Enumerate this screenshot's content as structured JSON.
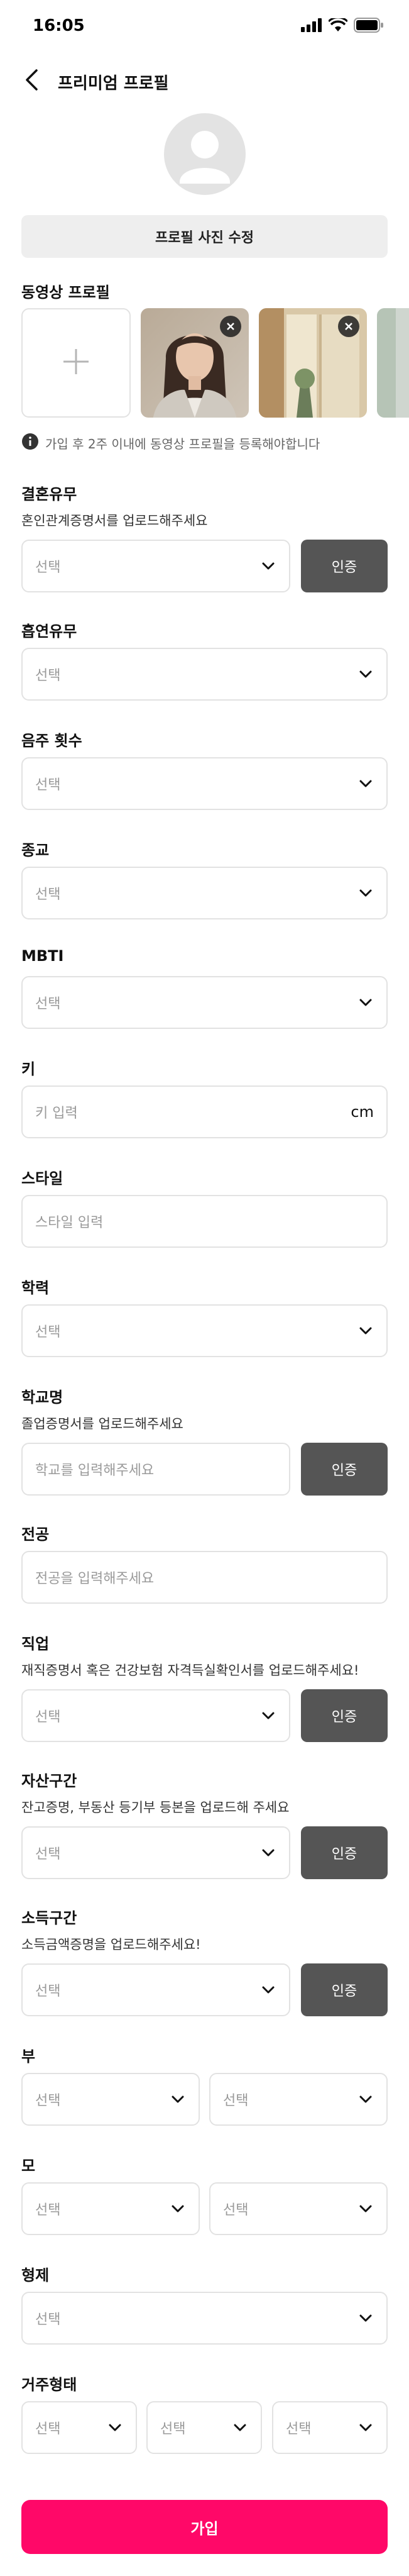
{
  "status": {
    "time": "16:05"
  },
  "nav": {
    "title": "프리미엄 프로필"
  },
  "profile": {
    "photo_edit_label": "프로필 사진 수정"
  },
  "video_profile": {
    "label": "동영상 프로필",
    "notice": "가입 후 2주 이내에 동영상 프로필을 등록해야합니다"
  },
  "common": {
    "select_placeholder": "선택",
    "cert_label": "인증"
  },
  "marriage": {
    "label": "결혼유무",
    "sub": "혼인관계증명서를 업로드해주세요"
  },
  "smoking": {
    "label": "흡연유무"
  },
  "drinking": {
    "label": "음주 횟수"
  },
  "religion": {
    "label": "종교"
  },
  "mbti": {
    "label": "MBTI"
  },
  "height": {
    "label": "키",
    "placeholder": "키 입력",
    "unit": "cm"
  },
  "style": {
    "label": "스타일",
    "placeholder": "스타일 입력"
  },
  "education": {
    "label": "학력"
  },
  "school": {
    "label": "학교명",
    "sub": "졸업증명서를 업로드해주세요",
    "placeholder": "학교를 입력해주세요"
  },
  "major": {
    "label": "전공",
    "placeholder": "전공을 입력해주세요"
  },
  "job": {
    "label": "직업",
    "sub": "재직증명서 혹은 건강보험 자격득실확인서를 업로드해주세요!"
  },
  "assets": {
    "label": "자산구간",
    "sub": "잔고증명, 부동산 등기부 등본을 업로드해 주세요"
  },
  "income": {
    "label": "소득구간",
    "sub": "소득금액증명을 업로드해주세요!"
  },
  "father": {
    "label": "부"
  },
  "mother": {
    "label": "모"
  },
  "siblings": {
    "label": "형제"
  },
  "residence": {
    "label": "거주형태"
  },
  "submit": {
    "label": "가입"
  },
  "colors": {
    "accent": "#ff0868",
    "cert_button": "#555555",
    "border": "#e2e2e2"
  }
}
